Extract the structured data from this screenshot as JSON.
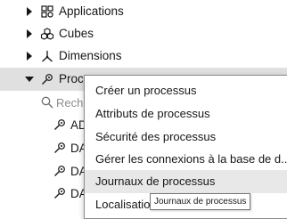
{
  "tree": {
    "items": [
      {
        "label": "Applications",
        "icon": "applications-icon"
      },
      {
        "label": "Cubes",
        "icon": "cubes-icon"
      },
      {
        "label": "Dimensions",
        "icon": "dimensions-icon"
      },
      {
        "label": "Processus",
        "icon": "process-icon"
      }
    ],
    "search_placeholder": "Rechercher",
    "sub_items": [
      "AD",
      "DA",
      "DA",
      "DA"
    ]
  },
  "context_menu": {
    "items": [
      "Créer un processus",
      "Attributs de processus",
      "Sécurité des processus",
      "Gérer les connexions à la base de d...",
      "Journaux de processus",
      "Localisation"
    ]
  },
  "tooltip": "Journaux de processus",
  "colors": {
    "selected_row": "#e0e0e0",
    "hover_item": "#e8e8e8",
    "border": "#8c8c8c"
  }
}
